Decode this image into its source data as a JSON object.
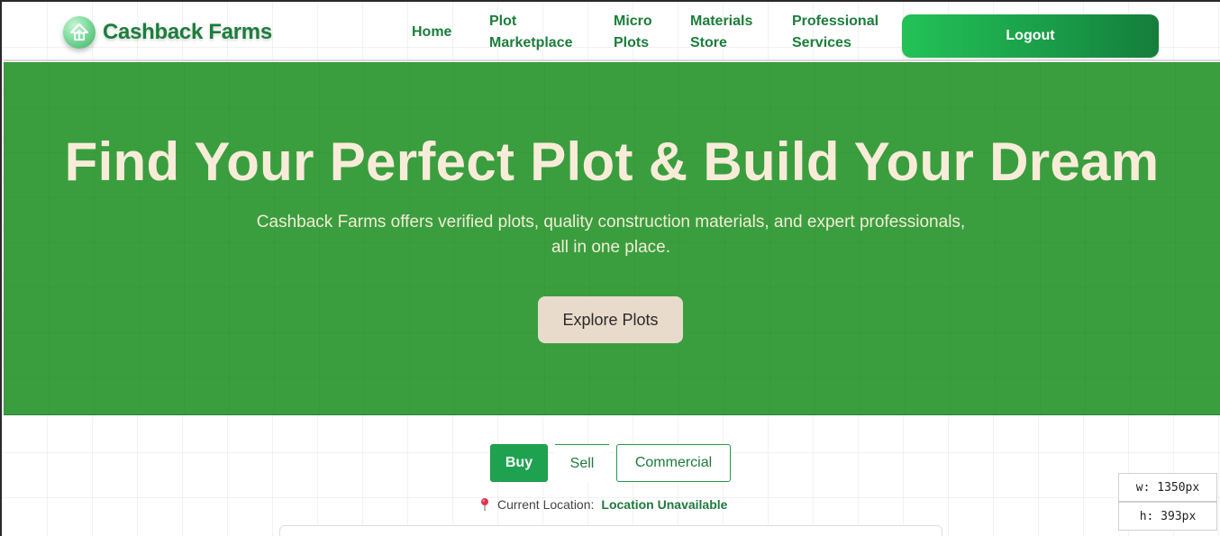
{
  "brand": {
    "name": "Cashback Farms",
    "icon": "house-arrow-icon",
    "color": "#1c7d3b"
  },
  "nav": {
    "items": [
      {
        "label": "Home"
      },
      {
        "label": "Plot\nMarketplace"
      },
      {
        "label": "Micro\nPlots"
      },
      {
        "label": "Materials\nStore"
      },
      {
        "label": "Professional\nServices"
      }
    ],
    "logout_label": "Logout"
  },
  "hero": {
    "title": "Find Your Perfect Plot & Build Your Dream",
    "subtitle": "Cashback Farms offers verified plots, quality construction materials, and expert professionals, all in one place.",
    "cta_label": "Explore Plots",
    "background_color": "#3a9e3f"
  },
  "tabs": [
    {
      "label": "Buy",
      "active": true
    },
    {
      "label": "Sell",
      "active": false
    },
    {
      "label": "Commercial",
      "active": false
    }
  ],
  "location": {
    "icon": "map-pin-icon",
    "label": "Current Location:",
    "value": "Location Unavailable"
  },
  "dimension_overlay": {
    "width_text": "w: 1350px",
    "height_text": "h: 393px"
  }
}
